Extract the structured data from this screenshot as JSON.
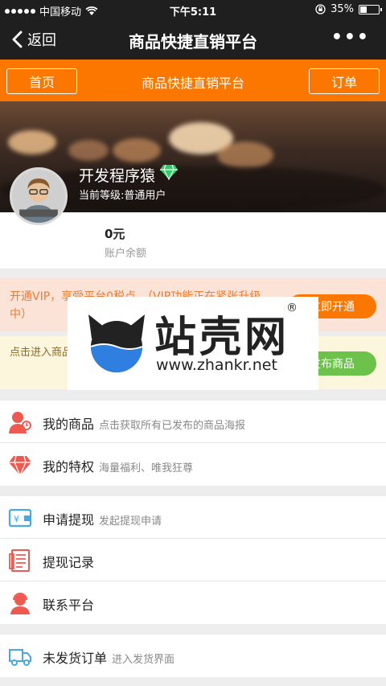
{
  "status_bar": {
    "carrier": "中国移动",
    "time": "下午5:11",
    "battery": "35%",
    "battery_level": 0.35
  },
  "nav": {
    "back_label": "返回",
    "title": "商品快捷直销平台",
    "more_label": "•••"
  },
  "header": {
    "home_label": "首页",
    "title": "商品快捷直销平台",
    "orders_label": "订单"
  },
  "profile": {
    "name": "开发程序猿",
    "level": "当前等级:普通用户",
    "balance_value": "0元",
    "balance_label": "账户余额"
  },
  "promo_vip": {
    "text": "开通VIP，享受平台0税点。（VIP功能正在紧张升级中）",
    "button": "立即开通"
  },
  "promo_goods": {
    "text": "点击进入商品，发布商品可在【我的商品】中查看",
    "button": "发布商品"
  },
  "watermark": {
    "title": "站壳网",
    "reg": "®",
    "url": "www.zhankr.net"
  },
  "menu": [
    {
      "label": "我的商品",
      "sub": "点击获取所有已发布的商品海报",
      "icon": "user-icon"
    },
    {
      "label": "我的特权",
      "sub": "海量福利、唯我狂尊",
      "icon": "diamond-icon"
    },
    {
      "label": "申请提现",
      "sub": "发起提现申请",
      "icon": "wallet-icon"
    },
    {
      "label": "提现记录",
      "sub": "",
      "icon": "record-icon"
    },
    {
      "label": "联系平台",
      "sub": "",
      "icon": "service-icon"
    },
    {
      "label": "未发货订单",
      "sub": "进入发货界面",
      "icon": "truck-icon"
    }
  ],
  "colors": {
    "accent": "#fb7700",
    "dark": "#1f1f1f",
    "green": "#6cc24a",
    "icon_red": "#ee5a4f",
    "icon_blue": "#4aa8e0"
  }
}
